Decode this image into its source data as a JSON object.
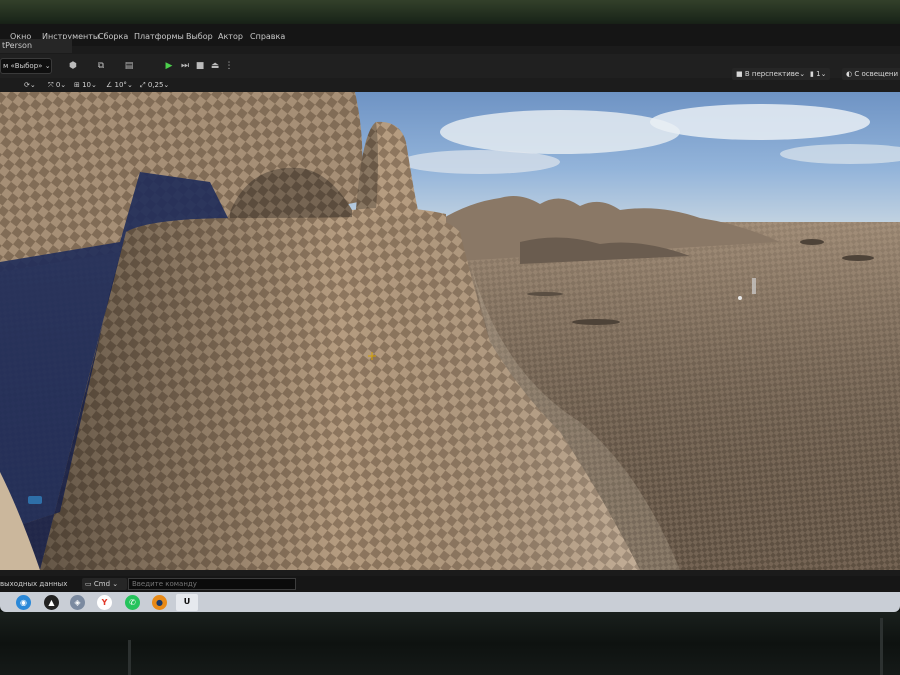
{
  "menu": {
    "items": [
      "Окно",
      "Инструменты",
      "Сборка",
      "Платформы",
      "Выбор",
      "Актор",
      "Справка"
    ],
    "level_name": "tPerson"
  },
  "toolbar": {
    "mode_select": "м «Выбор»"
  },
  "viewport_toolbar": {
    "rotation_snap": "0",
    "grid_snap": "10",
    "angle_snap": "10°",
    "scale_snap": "0,25",
    "view_mode": "В перспективе",
    "camera_speed": "1",
    "lighting_mode": "С освещени"
  },
  "console": {
    "output_log": "выходных данных",
    "cmd_label": "Cmd",
    "input_placeholder": "Введите команду"
  },
  "taskbar": {
    "apps": [
      "edge-icon",
      "cat-icon",
      "box-icon",
      "yandex-icon",
      "whatsapp-icon",
      "blender-icon",
      "unreal-icon"
    ]
  },
  "colors": {
    "play_green": "#4ccf4c",
    "editor_bg": "#1b1b1b",
    "sky": "#8fb4de",
    "terrain": "#a0896f"
  }
}
